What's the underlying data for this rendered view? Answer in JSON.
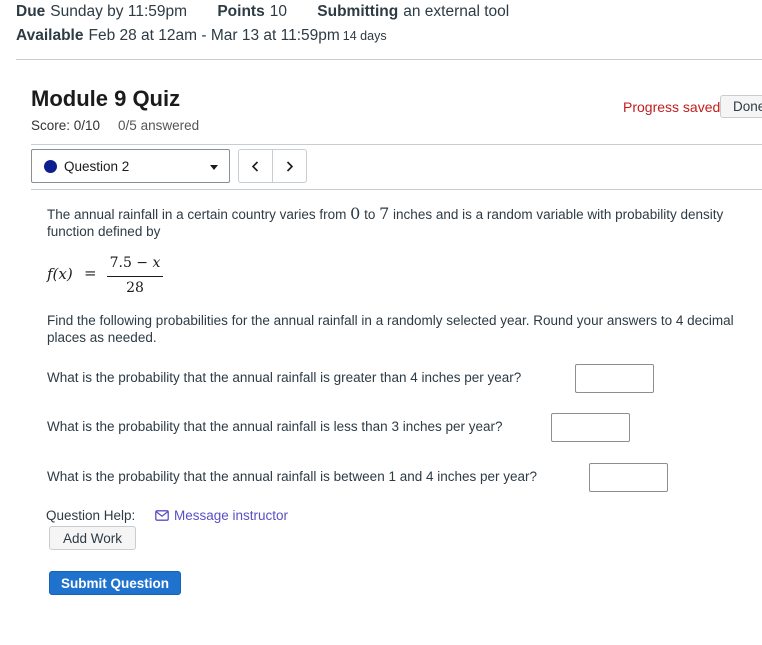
{
  "assignment": {
    "due_label": "Due",
    "due_value": "Sunday by 11:59pm",
    "points_label": "Points",
    "points_value": "10",
    "submitting_label": "Submitting",
    "submitting_value": "an external tool",
    "available_label": "Available",
    "available_value": "Feb 28 at 12am - Mar 13 at 11:59pm",
    "available_duration": "14 days"
  },
  "quiz": {
    "title": "Module 9 Quiz",
    "score": "Score: 0/10",
    "answered": "0/5 answered",
    "progress_status": "Progress saved",
    "done_label": "Done"
  },
  "navigation": {
    "current_question": "Question 2",
    "prev_label": "<",
    "next_label": ">"
  },
  "question": {
    "intro_part1": "The annual rainfall in a certain country varies from ",
    "range_low": "0",
    "intro_part2": " to ",
    "range_high": "7",
    "intro_part3": " inches and is a random variable with probability density function defined by",
    "formula": {
      "lhs": "f(x)",
      "equals": "=",
      "numerator_const": "7.5",
      "numerator_op": " − ",
      "numerator_var": "x",
      "denominator": "28"
    },
    "instructions": "Find the following probabilities for the annual rainfall in a randomly selected year. Round your answers to 4 decimal places as needed.",
    "parts": [
      {
        "prompt": "What is the probability that the annual rainfall is greater than 4 inches per year?",
        "value": ""
      },
      {
        "prompt": "What is the probability that the annual rainfall is less than 3 inches per year?",
        "value": ""
      },
      {
        "prompt": "What is the probability that the annual rainfall is between 1 and 4 inches per year?",
        "value": ""
      }
    ]
  },
  "help": {
    "label": "Question Help:",
    "message_instructor": "Message instructor",
    "add_work": "Add Work"
  },
  "actions": {
    "submit_label": "Submit Question"
  },
  "colors": {
    "accent": "#1f73cf",
    "progress_saved": "#c41c1c",
    "link": "#5a4fc4",
    "question_dot": "#0e1e8f"
  }
}
